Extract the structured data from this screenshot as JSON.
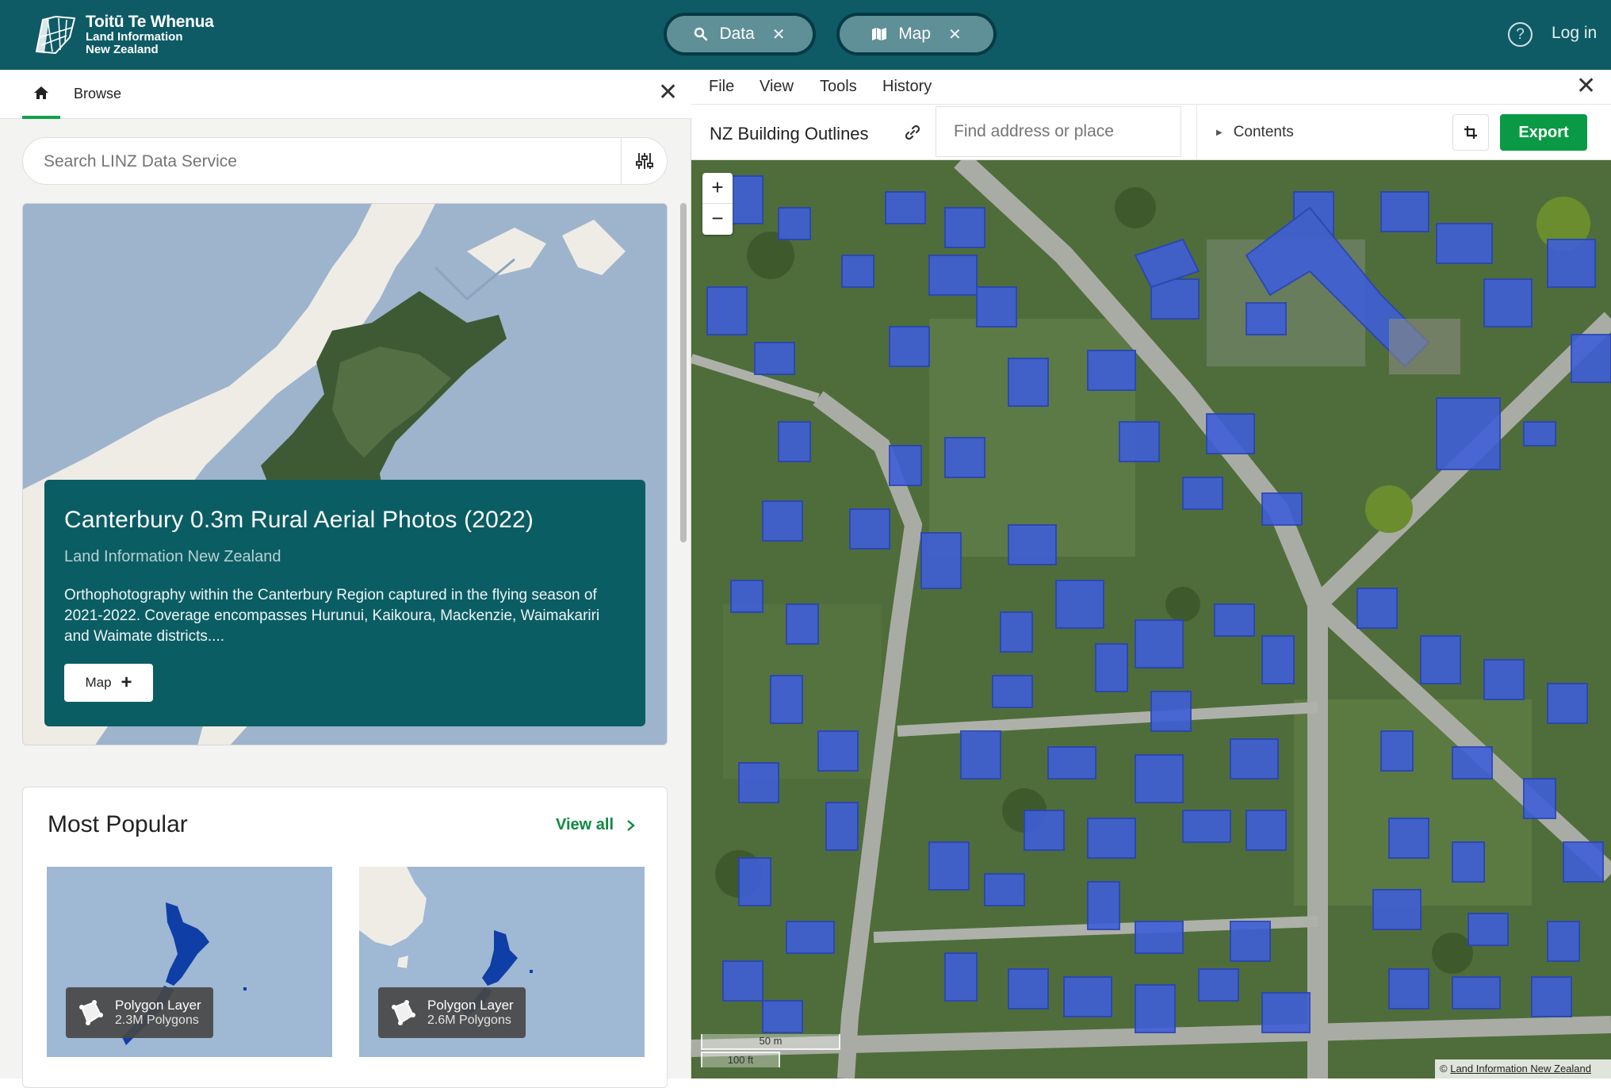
{
  "header": {
    "logo": {
      "line1": "Toitū Te Whenua",
      "line2": "Land Information",
      "line3": "New Zealand"
    },
    "tabs": [
      {
        "label": "Data",
        "icon": "search-icon"
      },
      {
        "label": "Map",
        "icon": "map-icon"
      }
    ],
    "login_label": "Log in",
    "help_symbol": "?"
  },
  "left_panel": {
    "browse_label": "Browse",
    "search_placeholder": "Search LINZ Data Service",
    "featured": {
      "title": "Canterbury 0.3m Rural Aerial Photos (2022)",
      "publisher": "Land Information New Zealand",
      "description": "Orthophotography within the Canterbury Region captured in the flying season of 2021-2022. Coverage encompasses Hurunui, Kaikoura, Mackenzie, Waimakariri and Waimate districts....",
      "map_button_label": "Map"
    },
    "popular": {
      "title": "Most Popular",
      "view_all_label": "View all",
      "items": [
        {
          "type_label": "Polygon Layer",
          "count_label": "2.3M Polygons"
        },
        {
          "type_label": "Polygon Layer",
          "count_label": "2.6M Polygons"
        }
      ]
    }
  },
  "right_panel": {
    "menu": [
      "File",
      "View",
      "Tools",
      "History"
    ],
    "layer_title": "NZ Building Outlines",
    "find_placeholder": "Find address or place",
    "contents_label": "Contents",
    "export_label": "Export",
    "map": {
      "zoom_in": "+",
      "zoom_out": "−",
      "scale_metric": "50 m",
      "scale_imperial": "100 ft",
      "attribution_prefix": "©",
      "attribution": "Land Information New Zealand"
    }
  },
  "colors": {
    "header_bg": "#0e5b66",
    "accent_green": "#0a9a45",
    "feature_card_bg": "#0b5d64",
    "building_fill": "#3f5fd8"
  }
}
